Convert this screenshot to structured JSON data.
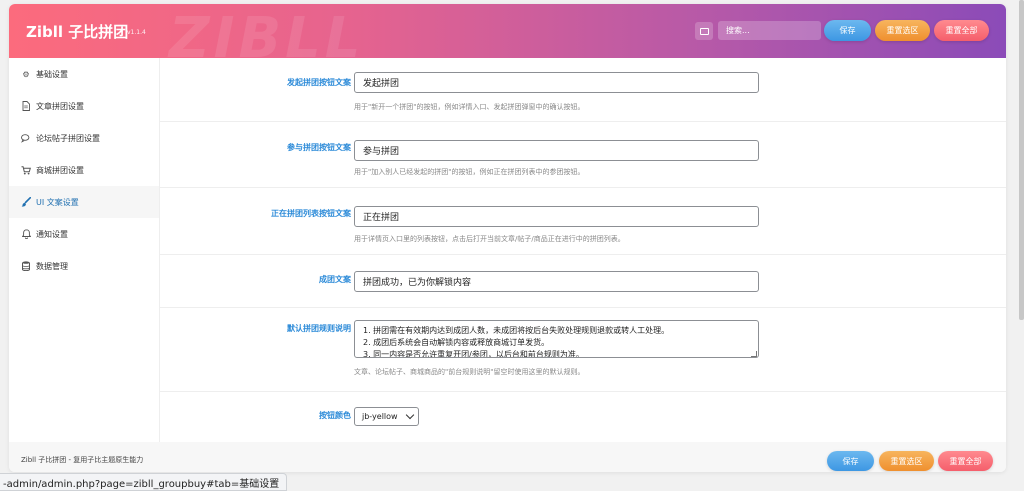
{
  "header": {
    "brand": "Zibll 子比拼团",
    "version": "v1.1.4",
    "search_placeholder": "搜索...",
    "save_label": "保存",
    "reset_section_label": "重置选区",
    "reset_all_label": "重置全部",
    "menu_icon": "list-icon"
  },
  "sidebar": {
    "items": [
      {
        "label": "基础设置",
        "icon": "gear-icon"
      },
      {
        "label": "文章拼团设置",
        "icon": "file-icon"
      },
      {
        "label": "论坛帖子拼团设置",
        "icon": "comments-icon"
      },
      {
        "label": "商城拼团设置",
        "icon": "cart-icon"
      },
      {
        "label": "UI 文案设置",
        "icon": "brush-icon"
      },
      {
        "label": "通知设置",
        "icon": "bell-icon"
      },
      {
        "label": "数据管理",
        "icon": "database-icon"
      }
    ],
    "active_index": 4
  },
  "form": {
    "start_button": {
      "label": "发起拼团按钮文案",
      "value": "发起拼团",
      "desc": "用于\"新开一个拼团\"的按钮，例如详情入口、发起拼团弹窗中的确认按钮。"
    },
    "join_button": {
      "label": "参与拼团按钮文案",
      "value": "参与拼团",
      "desc": "用于\"加入别人已经发起的拼团\"的按钮，例如正在拼团列表中的参团按钮。"
    },
    "list_button": {
      "label": "正在拼团列表按钮文案",
      "value": "正在拼团",
      "desc": "用于详情页入口里的列表按钮，点击后打开当前文章/帖子/商品正在进行中的拼团列表。"
    },
    "success_text": {
      "label": "成团文案",
      "value": "拼团成功，已为你解锁内容"
    },
    "rules": {
      "label": "默认拼团规则说明",
      "value": "1. 拼团需在有效期内达到成团人数，未成团将按后台失败处理规则退款或转人工处理。\n2. 成团后系统会自动解锁内容或释放商城订单发货。\n3. 同一内容是否允许重复开团/参团，以后台和前台规则为准。",
      "desc": "文章、论坛帖子、商城商品的\"前台规则说明\"留空时使用这里的默认规则。"
    },
    "button_color": {
      "label": "按钮颜色",
      "value": "jb-yellow"
    }
  },
  "footer": {
    "text": "Zibll 子比拼团 - 复用子比主题原生能力",
    "save_label": "保存",
    "reset_section_label": "重置选区",
    "reset_all_label": "重置全部"
  },
  "statusbar": {
    "url": "-admin/admin.php?page=zibll_groupbuy#tab=基础设置"
  },
  "colors": {
    "header_gradient_start": "#fc6b7d",
    "header_gradient_end": "#8b4bb8",
    "label_blue": "#2b8ad8",
    "active_nav": "#2271b1"
  }
}
